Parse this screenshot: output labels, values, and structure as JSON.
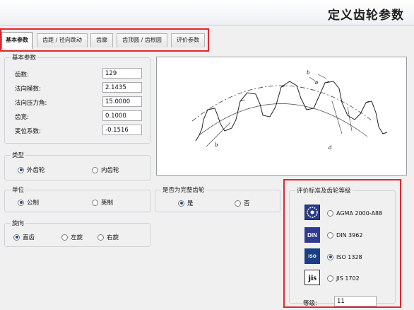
{
  "header": {
    "title": "定义齿轮参数"
  },
  "tabs": [
    {
      "label": "基本参数",
      "active": true
    },
    {
      "label": "齿距 / 径向跳动",
      "active": false
    },
    {
      "label": "齿廓",
      "active": false
    },
    {
      "label": "齿顶圆 / 齿根圆",
      "active": false
    },
    {
      "label": "评价参数",
      "active": false
    }
  ],
  "basic_params": {
    "title": "基本参数",
    "rows": [
      {
        "label": "齿数:",
        "value": "129"
      },
      {
        "label": "法向模数:",
        "value": "2.1435"
      },
      {
        "label": "法向压力角:",
        "value": "15.0000"
      },
      {
        "label": "齿宽:",
        "value": "0.1000"
      },
      {
        "label": "变位系数:",
        "value": "-0.1516"
      }
    ]
  },
  "gear_type": {
    "title": "类型",
    "options": [
      "外齿轮",
      "内齿轮"
    ],
    "selected": "外齿轮"
  },
  "unit": {
    "title": "单位",
    "options": [
      "公制",
      "英制"
    ],
    "selected": "公制"
  },
  "helix": {
    "title": "旋向",
    "options": [
      "直齿",
      "左旋",
      "右旋"
    ],
    "selected": "直齿"
  },
  "complete_gear": {
    "title": "是否为完整齿轮",
    "options": [
      "是",
      "否"
    ],
    "selected": "是"
  },
  "drawing": {
    "labels": [
      "b",
      "a",
      "d",
      "b"
    ]
  },
  "standards": {
    "title": "评价标准及齿轮等级",
    "options": [
      {
        "label": "AGMA 2000-A88",
        "icon": "agma-logo-icon"
      },
      {
        "label": "DIN 3962",
        "icon": "din-logo-icon",
        "logo_text": "DIN"
      },
      {
        "label": "ISO 1328",
        "icon": "iso-logo-icon",
        "logo_text": "ISO"
      },
      {
        "label": "JIS 1702",
        "icon": "jis-logo-icon",
        "logo_text": "jis"
      }
    ],
    "selected": "ISO 1328",
    "grade_label": "等级:",
    "grade_value": "11"
  },
  "colors": {
    "highlight": "#e0282d",
    "radio_fill": "#2a4b8d"
  }
}
